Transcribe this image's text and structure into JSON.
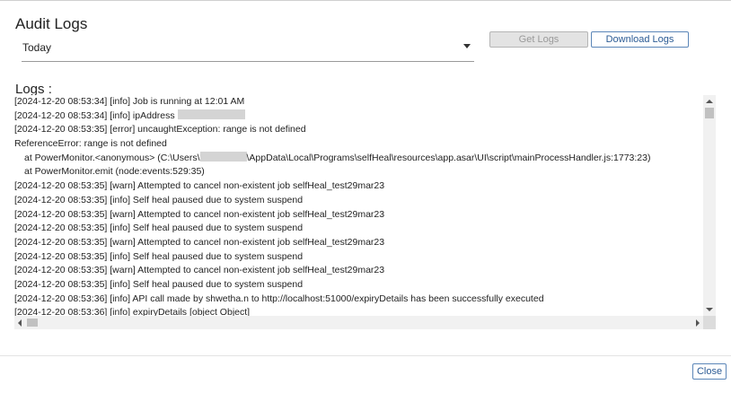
{
  "dialog": {
    "title": "Audit Logs",
    "close_label": "Close"
  },
  "filter": {
    "selected": "Today"
  },
  "toolbar": {
    "get_logs_label": "Get Logs",
    "download_logs_label": "Download Logs"
  },
  "logs": {
    "heading": "Logs :",
    "lines": [
      {
        "pre": "[2024-12-20 08:53:34] [info] Job is running at 12:01 AM",
        "post": "",
        "redacted": false,
        "indent": false
      },
      {
        "pre": "[2024-12-20 08:53:34] [info] ipAddress ",
        "post": "",
        "redacted": true,
        "indent": false
      },
      {
        "pre": "[2024-12-20 08:53:35] [error] uncaughtException: range is not defined",
        "post": "",
        "redacted": false,
        "indent": false
      },
      {
        "pre": "ReferenceError: range is not defined",
        "post": "",
        "redacted": false,
        "indent": false
      },
      {
        "pre": "at PowerMonitor.<anonymous> (C:\\Users\\",
        "post": "\\AppData\\Local\\Programs\\selfHeal\\resources\\app.asar\\UI\\script\\mainProcessHandler.js:1773:23)",
        "redacted": true,
        "indent": true
      },
      {
        "pre": "at PowerMonitor.emit (node:events:529:35)",
        "post": "",
        "redacted": false,
        "indent": true
      },
      {
        "pre": "[2024-12-20 08:53:35] [warn] Attempted to cancel non-existent job selfHeal_test29mar23",
        "post": "",
        "redacted": false,
        "indent": false
      },
      {
        "pre": "[2024-12-20 08:53:35] [info] Self heal paused due to system suspend",
        "post": "",
        "redacted": false,
        "indent": false
      },
      {
        "pre": "[2024-12-20 08:53:35] [warn] Attempted to cancel non-existent job selfHeal_test29mar23",
        "post": "",
        "redacted": false,
        "indent": false
      },
      {
        "pre": "[2024-12-20 08:53:35] [info] Self heal paused due to system suspend",
        "post": "",
        "redacted": false,
        "indent": false
      },
      {
        "pre": "[2024-12-20 08:53:35] [warn] Attempted to cancel non-existent job selfHeal_test29mar23",
        "post": "",
        "redacted": false,
        "indent": false
      },
      {
        "pre": "[2024-12-20 08:53:35] [info] Self heal paused due to system suspend",
        "post": "",
        "redacted": false,
        "indent": false
      },
      {
        "pre": "[2024-12-20 08:53:35] [warn] Attempted to cancel non-existent job selfHeal_test29mar23",
        "post": "",
        "redacted": false,
        "indent": false
      },
      {
        "pre": "[2024-12-20 08:53:35] [info] Self heal paused due to system suspend",
        "post": "",
        "redacted": false,
        "indent": false
      },
      {
        "pre": "[2024-12-20 08:53:36] [info] API call made by shwetha.n to http://localhost:51000/expiryDetails has been successfully executed",
        "post": "",
        "redacted": false,
        "indent": false
      },
      {
        "pre": "[2024-12-20 08:53:36] [info] expiryDetails [object Object]",
        "post": "",
        "redacted": false,
        "indent": false
      }
    ]
  }
}
